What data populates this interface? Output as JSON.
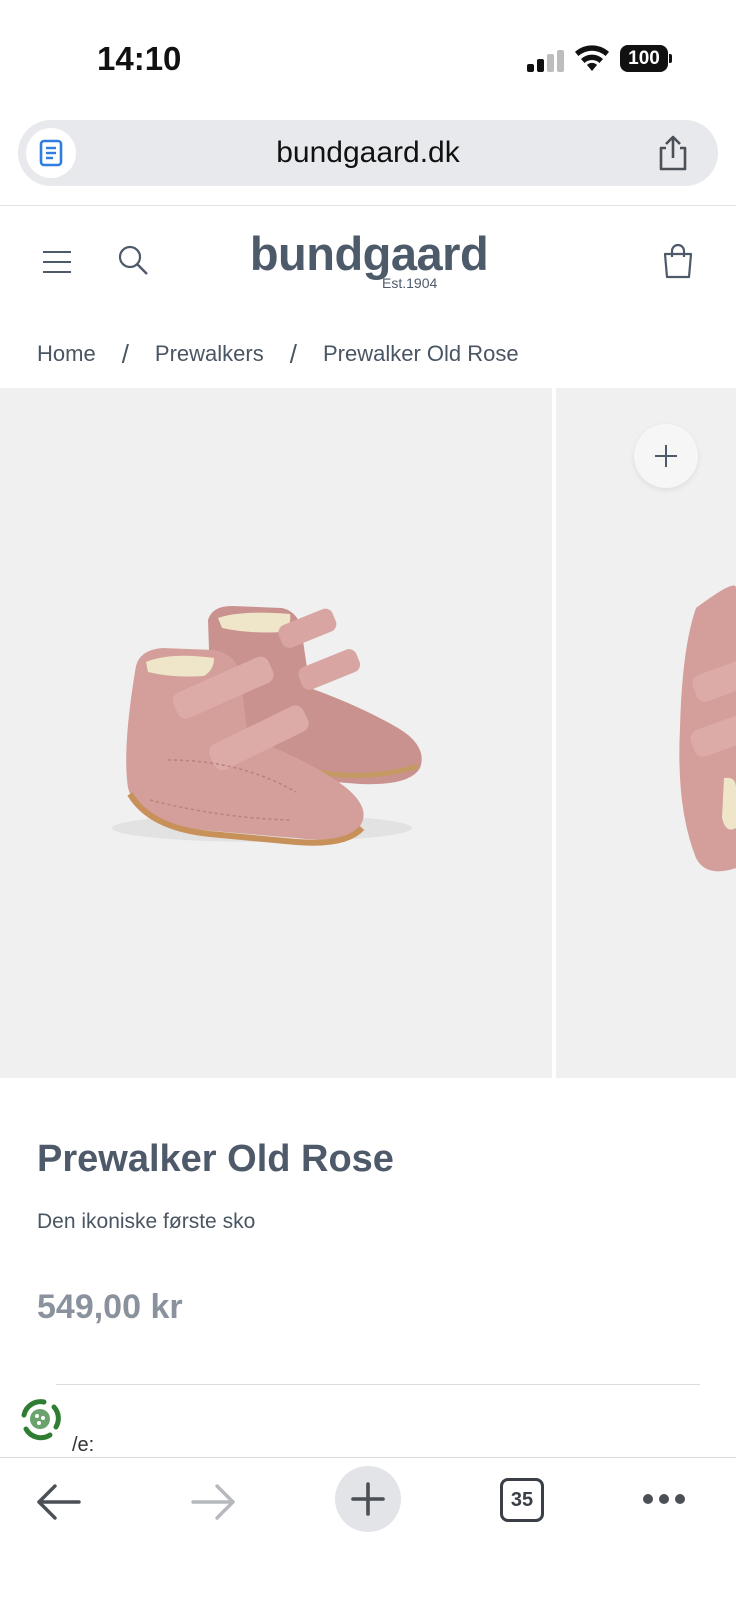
{
  "status_bar": {
    "time": "14:10",
    "battery": "100"
  },
  "browser": {
    "url": "bundgaard.dk",
    "open_tabs_count": "35"
  },
  "site": {
    "logo_text": "bundgaard",
    "logo_tagline": "Est.1904"
  },
  "breadcrumb": {
    "items": [
      "Home",
      "Prewalkers",
      "Prewalker Old Rose"
    ],
    "separator": "/"
  },
  "product": {
    "title": "Prewalker Old Rose",
    "subtitle": "Den ikoniske første sko",
    "price": "549,00 kr",
    "partial_label": "/e:"
  },
  "colors": {
    "brand_text": "#4d5a6a",
    "shoe_pink": "#d49e9b",
    "gallery_bg": "#f0f0f0",
    "eco_green": "#2f7d32"
  },
  "icons": {
    "reader": "reader-icon",
    "share": "share-icon",
    "menu": "menu-icon",
    "search": "search-icon",
    "bag": "shopping-bag-icon",
    "zoom": "plus-icon",
    "back": "arrow-left-icon",
    "forward": "arrow-right-icon",
    "new_tab": "plus-icon",
    "more": "more-dots-icon",
    "eco": "eco-badge-icon"
  }
}
